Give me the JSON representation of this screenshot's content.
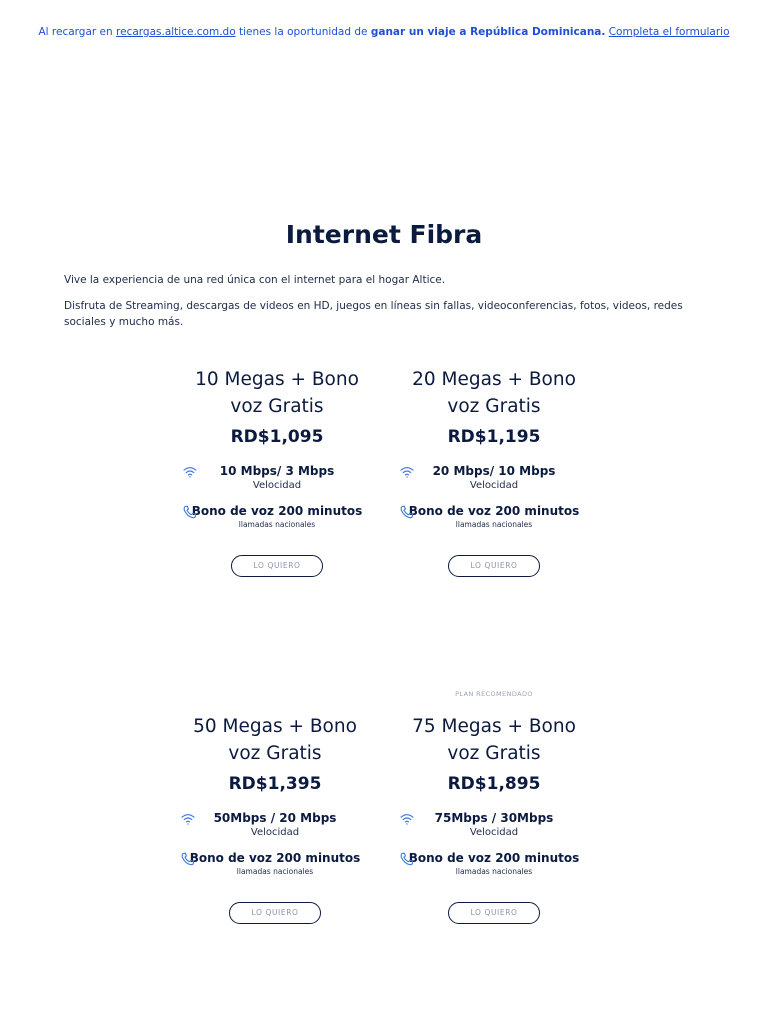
{
  "banner": {
    "prefix": "Al recargar en",
    "link": "recargas.altice.com.do",
    "middle": "tienes la oportunidad de",
    "bold": "ganar un viaje a República Dominicana.",
    "cta": "Completa el formulario"
  },
  "page": {
    "title": "Internet Fibra",
    "intro1": "Vive la experiencia de una red única con el internet para el hogar Altice.",
    "intro2": "Disfruta de Streaming, descargas de videos en HD, juegos en líneas sin fallas, videoconferencias, fotos, videos, redes sociales y mucho más."
  },
  "recommended_label": "PLAN RECOMENDADO",
  "plans": [
    {
      "name_line1": "10 Megas + Bono",
      "name_line2": "voz Gratis",
      "price": "RD$1,095",
      "speed": "10 Mbps/ 3 Mbps",
      "speed_label": "Velocidad",
      "voice": "Bono de voz 200 minutos",
      "voice_label": "llamadas nacionales",
      "button": "LO QUIERO"
    },
    {
      "name_line1": "20 Megas + Bono",
      "name_line2": "voz Gratis",
      "price": "RD$1,195",
      "speed": "20 Mbps/ 10 Mbps",
      "speed_label": "Velocidad",
      "voice": "Bono de voz 200 minutos",
      "voice_label": "llamadas nacionales",
      "button": "LO QUIERO"
    },
    {
      "name_line1": "50 Megas + Bono",
      "name_line2": "voz Gratis",
      "price": "RD$1,395",
      "speed": "50Mbps / 20 Mbps",
      "speed_label": "Velocidad",
      "voice": "Bono de voz 200 minutos",
      "voice_label": "llamadas nacionales",
      "button": "LO QUIERO"
    },
    {
      "name_line1": "75 Megas + Bono",
      "name_line2": "voz Gratis",
      "price": "RD$1,895",
      "speed": "75Mbps / 30Mbps",
      "speed_label": "Velocidad",
      "voice": "Bono de voz 200 minutos",
      "voice_label": "llamadas nacionales",
      "button": "LO QUIERO"
    }
  ],
  "icons": {
    "speed": "wifi-icon",
    "voice": "phone-icon"
  },
  "colors": {
    "accent": "#1f4fd6",
    "navy": "#0b1a3f",
    "icon": "#3d78d8"
  }
}
